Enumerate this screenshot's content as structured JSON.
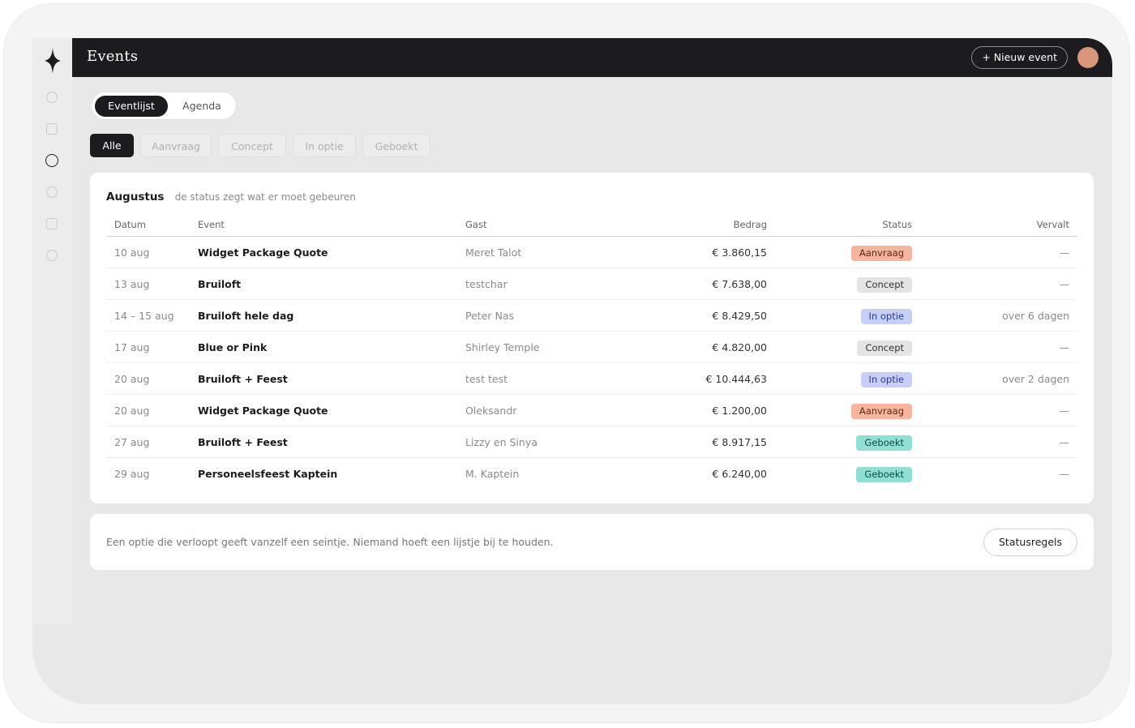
{
  "topbar": {
    "title": "Events",
    "new_event_label": "+ Nieuw event"
  },
  "sidebar": {
    "icons": [
      "circle-icon",
      "square-icon",
      "circle-icon",
      "circle-icon",
      "square-icon",
      "circle-icon"
    ],
    "active_index": 2
  },
  "view_toggle": {
    "list_label": "Eventlijst",
    "agenda_label": "Agenda",
    "active": "Eventlijst"
  },
  "filters": [
    {
      "label": "Alle",
      "active": true
    },
    {
      "label": "Aanvraag",
      "active": false
    },
    {
      "label": "Concept",
      "active": false
    },
    {
      "label": "In optie",
      "active": false
    },
    {
      "label": "Geboekt",
      "active": false
    }
  ],
  "events_card": {
    "month": "Augustus",
    "subtitle": "de status zegt wat er moet gebeuren",
    "columns": [
      "Datum",
      "Event",
      "Gast",
      "Bedrag",
      "Status",
      "Vervalt"
    ],
    "rows": [
      {
        "date": "10 aug",
        "event": "Widget Package Quote",
        "guest": "Meret Talot",
        "amount": "€ 3.860,15",
        "status": "Aanvraag",
        "expires": "—"
      },
      {
        "date": "13 aug",
        "event": "Bruiloft",
        "guest": "testchar",
        "amount": "€ 7.638,00",
        "status": "Concept",
        "expires": "—"
      },
      {
        "date": "14 – 15 aug",
        "event": "Bruiloft hele dag",
        "guest": "Peter Nas",
        "amount": "€ 8.429,50",
        "status": "In optie",
        "expires": "over 6 dagen"
      },
      {
        "date": "17 aug",
        "event": "Blue or Pink",
        "guest": "Shirley Temple",
        "amount": "€ 4.820,00",
        "status": "Concept",
        "expires": "—"
      },
      {
        "date": "20 aug",
        "event": "Bruiloft + Feest",
        "guest": "test test",
        "amount": "€ 10.444,63",
        "status": "In optie",
        "expires": "over 2 dagen"
      },
      {
        "date": "20 aug",
        "event": "Widget Package Quote",
        "guest": "Oleksandr",
        "amount": "€ 1.200,00",
        "status": "Aanvraag",
        "expires": "—"
      },
      {
        "date": "27 aug",
        "event": "Bruiloft + Feest",
        "guest": "Lizzy en Sinya",
        "amount": "€ 8.917,15",
        "status": "Geboekt",
        "expires": "—"
      },
      {
        "date": "29 aug",
        "event": "Personeelsfeest Kaptein",
        "guest": "M. Kaptein",
        "amount": "€ 6.240,00",
        "status": "Geboekt",
        "expires": "—"
      }
    ]
  },
  "status_colors": {
    "Aanvraag": {
      "bg": "#f6b49c",
      "fg": "#5a2a18"
    },
    "Concept": {
      "bg": "#e4e4e4",
      "fg": "#333333"
    },
    "In optie": {
      "bg": "#c7cff8",
      "fg": "#2a3a8a"
    },
    "Geboekt": {
      "bg": "#8fe0d2",
      "fg": "#0e4a42"
    }
  },
  "info_card": {
    "text": "Een optie die verloopt geeft vanzelf een seintje. Niemand hoeft een lijstje bij te houden.",
    "button_label": "Statusregels"
  },
  "colors": {
    "dark": "#1c1c1e",
    "avatar": "#d9967a"
  }
}
